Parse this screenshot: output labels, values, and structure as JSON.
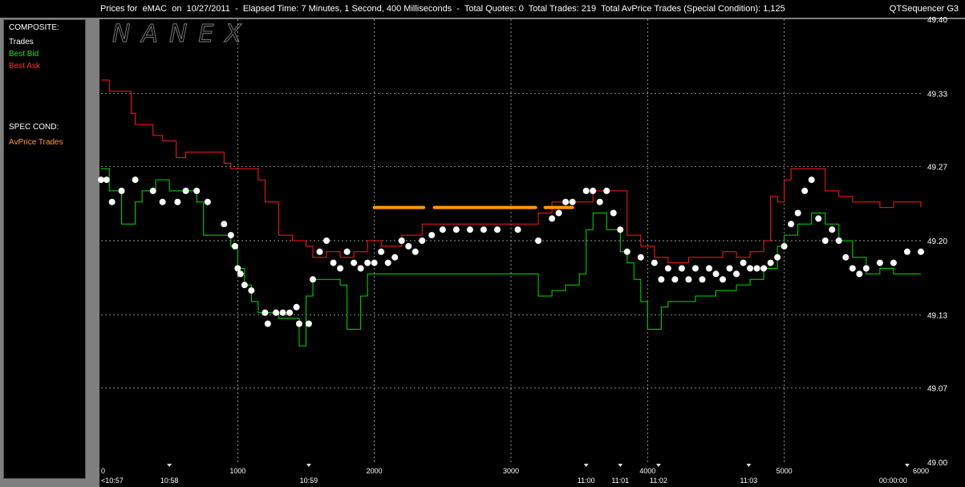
{
  "header": {
    "title": "Prices for  eMAC  on  10/27/2011  -  Elapsed Time: 7 Minutes, 1 Second, 400 Milliseconds  -  Total Quotes: 0  Total Trades: 219  Total AvPrice Trades (Special Condition): 1,125",
    "app": "QTSequencer G3"
  },
  "legend": {
    "composite": "COMPOSITE:",
    "trades": "Trades",
    "best_bid": "Best Bid",
    "best_ask": "Best Ask",
    "spec_cond": "SPEC COND:",
    "avprice": "AvPrice Trades"
  },
  "watermark": "NANEX",
  "colors": {
    "trades": "#ffffff",
    "bid": "#00dd00",
    "ask": "#ff1a1a",
    "avprice": "#ff9900",
    "grid": "#cccccc",
    "text": "#ffffff"
  },
  "chart_data": {
    "type": "line",
    "title": "",
    "ylim": [
      49.0,
      49.4
    ],
    "xlim": [
      0,
      6000
    ],
    "yticks": [
      "49.40",
      "49.33",
      "49.27",
      "49.20",
      "49.13",
      "49.07",
      "49.00"
    ],
    "yvals": [
      49.4,
      49.333,
      49.267,
      49.2,
      49.133,
      49.067,
      49.0
    ],
    "xticks": [
      {
        "v": 0,
        "l": "0"
      },
      {
        "v": 1000,
        "l": "1000"
      },
      {
        "v": 2000,
        "l": "2000"
      },
      {
        "v": 3000,
        "l": "3000"
      },
      {
        "v": 4000,
        "l": "4000"
      },
      {
        "v": 5000,
        "l": "5000"
      },
      {
        "v": 6000,
        "l": "6000"
      }
    ],
    "timeticks": [
      {
        "v": 0,
        "l": "<10:57"
      },
      {
        "v": 500,
        "l": "10:58"
      },
      {
        "v": 1520,
        "l": "10:59"
      },
      {
        "v": 3550,
        "l": "11:00"
      },
      {
        "v": 3800,
        "l": "11:01"
      },
      {
        "v": 4080,
        "l": "11:02"
      },
      {
        "v": 4740,
        "l": "11:03"
      },
      {
        "v": 5900,
        "l": "00:00:00"
      }
    ],
    "series": [
      {
        "name": "Best Ask",
        "key": "ask",
        "points": [
          [
            0,
            49.345
          ],
          [
            60,
            49.335
          ],
          [
            220,
            49.315
          ],
          [
            250,
            49.305
          ],
          [
            280,
            49.305
          ],
          [
            380,
            49.295
          ],
          [
            450,
            49.29
          ],
          [
            550,
            49.275
          ],
          [
            620,
            49.28
          ],
          [
            700,
            49.28
          ],
          [
            820,
            49.28
          ],
          [
            900,
            49.27
          ],
          [
            950,
            49.265
          ],
          [
            1050,
            49.265
          ],
          [
            1150,
            49.255
          ],
          [
            1200,
            49.235
          ],
          [
            1300,
            49.205
          ],
          [
            1400,
            49.2
          ],
          [
            1500,
            49.195
          ],
          [
            1550,
            49.185
          ],
          [
            1650,
            49.19
          ],
          [
            1750,
            49.185
          ],
          [
            1850,
            49.19
          ],
          [
            1950,
            49.2
          ],
          [
            2050,
            49.195
          ],
          [
            2200,
            49.205
          ],
          [
            2350,
            49.215
          ],
          [
            2500,
            49.215
          ],
          [
            2700,
            49.215
          ],
          [
            2900,
            49.215
          ],
          [
            3100,
            49.215
          ],
          [
            3200,
            49.225
          ],
          [
            3300,
            49.235
          ],
          [
            3400,
            49.235
          ],
          [
            3500,
            49.235
          ],
          [
            3600,
            49.245
          ],
          [
            3700,
            49.245
          ],
          [
            3800,
            49.245
          ],
          [
            3850,
            49.205
          ],
          [
            3950,
            49.195
          ],
          [
            4050,
            49.185
          ],
          [
            4150,
            49.18
          ],
          [
            4300,
            49.185
          ],
          [
            4400,
            49.185
          ],
          [
            4550,
            49.19
          ],
          [
            4650,
            49.185
          ],
          [
            4750,
            49.19
          ],
          [
            4850,
            49.2
          ],
          [
            4900,
            49.24
          ],
          [
            4950,
            49.235
          ],
          [
            5000,
            49.255
          ],
          [
            5050,
            49.265
          ],
          [
            5150,
            49.265
          ],
          [
            5300,
            49.245
          ],
          [
            5400,
            49.24
          ],
          [
            5500,
            49.235
          ],
          [
            5600,
            49.235
          ],
          [
            5700,
            49.23
          ],
          [
            5800,
            49.235
          ],
          [
            6000,
            49.23
          ]
        ]
      },
      {
        "name": "Best Bid",
        "key": "bid",
        "points": [
          [
            0,
            49.265
          ],
          [
            60,
            49.245
          ],
          [
            150,
            49.215
          ],
          [
            250,
            49.235
          ],
          [
            300,
            49.245
          ],
          [
            400,
            49.255
          ],
          [
            500,
            49.245
          ],
          [
            600,
            49.245
          ],
          [
            700,
            49.235
          ],
          [
            750,
            49.205
          ],
          [
            850,
            49.205
          ],
          [
            950,
            49.195
          ],
          [
            1000,
            49.175
          ],
          [
            1050,
            49.16
          ],
          [
            1100,
            49.145
          ],
          [
            1150,
            49.135
          ],
          [
            1250,
            49.135
          ],
          [
            1300,
            49.13
          ],
          [
            1350,
            49.13
          ],
          [
            1400,
            49.13
          ],
          [
            1450,
            49.105
          ],
          [
            1500,
            49.15
          ],
          [
            1550,
            49.165
          ],
          [
            1650,
            49.165
          ],
          [
            1750,
            49.16
          ],
          [
            1800,
            49.12
          ],
          [
            1850,
            49.12
          ],
          [
            1900,
            49.15
          ],
          [
            1950,
            49.17
          ],
          [
            2000,
            49.17
          ],
          [
            2050,
            49.17
          ],
          [
            2150,
            49.17
          ],
          [
            2350,
            49.17
          ],
          [
            2500,
            49.17
          ],
          [
            2700,
            49.17
          ],
          [
            2900,
            49.17
          ],
          [
            3100,
            49.17
          ],
          [
            3200,
            49.15
          ],
          [
            3300,
            49.155
          ],
          [
            3400,
            49.16
          ],
          [
            3500,
            49.17
          ],
          [
            3550,
            49.21
          ],
          [
            3600,
            49.225
          ],
          [
            3700,
            49.21
          ],
          [
            3800,
            49.19
          ],
          [
            3850,
            49.18
          ],
          [
            3900,
            49.165
          ],
          [
            3950,
            49.145
          ],
          [
            4000,
            49.12
          ],
          [
            4050,
            49.12
          ],
          [
            4100,
            49.14
          ],
          [
            4150,
            49.145
          ],
          [
            4250,
            49.145
          ],
          [
            4350,
            49.15
          ],
          [
            4500,
            49.155
          ],
          [
            4650,
            49.16
          ],
          [
            4750,
            49.165
          ],
          [
            4850,
            49.175
          ],
          [
            4950,
            49.195
          ],
          [
            5000,
            49.205
          ],
          [
            5100,
            49.215
          ],
          [
            5200,
            49.225
          ],
          [
            5300,
            49.215
          ],
          [
            5400,
            49.2
          ],
          [
            5500,
            49.185
          ],
          [
            5600,
            49.17
          ],
          [
            5700,
            49.175
          ],
          [
            5800,
            49.17
          ],
          [
            6000,
            49.17
          ]
        ]
      }
    ],
    "trades": [
      [
        0,
        49.255
      ],
      [
        40,
        49.255
      ],
      [
        80,
        49.235
      ],
      [
        150,
        49.245
      ],
      [
        250,
        49.255
      ],
      [
        380,
        49.245
      ],
      [
        450,
        49.235
      ],
      [
        560,
        49.235
      ],
      [
        620,
        49.245
      ],
      [
        700,
        49.245
      ],
      [
        780,
        49.235
      ],
      [
        900,
        49.215
      ],
      [
        950,
        49.205
      ],
      [
        980,
        49.195
      ],
      [
        1000,
        49.175
      ],
      [
        1020,
        49.17
      ],
      [
        1050,
        49.16
      ],
      [
        1100,
        49.155
      ],
      [
        1200,
        49.135
      ],
      [
        1220,
        49.125
      ],
      [
        1280,
        49.135
      ],
      [
        1330,
        49.135
      ],
      [
        1380,
        49.135
      ],
      [
        1430,
        49.14
      ],
      [
        1450,
        49.125
      ],
      [
        1520,
        49.125
      ],
      [
        1550,
        49.165
      ],
      [
        1600,
        49.19
      ],
      [
        1650,
        49.2
      ],
      [
        1700,
        49.18
      ],
      [
        1750,
        49.175
      ],
      [
        1800,
        49.19
      ],
      [
        1850,
        49.18
      ],
      [
        1900,
        49.175
      ],
      [
        1950,
        49.18
      ],
      [
        2000,
        49.18
      ],
      [
        2050,
        49.19
      ],
      [
        2100,
        49.18
      ],
      [
        2150,
        49.185
      ],
      [
        2200,
        49.2
      ],
      [
        2250,
        49.195
      ],
      [
        2300,
        49.19
      ],
      [
        2350,
        49.2
      ],
      [
        2420,
        49.205
      ],
      [
        2500,
        49.21
      ],
      [
        2600,
        49.21
      ],
      [
        2700,
        49.21
      ],
      [
        2800,
        49.21
      ],
      [
        2900,
        49.21
      ],
      [
        3050,
        49.21
      ],
      [
        3200,
        49.2
      ],
      [
        3300,
        49.22
      ],
      [
        3350,
        49.225
      ],
      [
        3400,
        49.235
      ],
      [
        3450,
        49.235
      ],
      [
        3550,
        49.245
      ],
      [
        3600,
        49.245
      ],
      [
        3650,
        49.235
      ],
      [
        3700,
        49.245
      ],
      [
        3750,
        49.225
      ],
      [
        3800,
        49.21
      ],
      [
        3850,
        49.19
      ],
      [
        3950,
        49.185
      ],
      [
        4050,
        49.18
      ],
      [
        4100,
        49.165
      ],
      [
        4150,
        49.175
      ],
      [
        4200,
        49.165
      ],
      [
        4250,
        49.175
      ],
      [
        4300,
        49.165
      ],
      [
        4350,
        49.175
      ],
      [
        4400,
        49.165
      ],
      [
        4450,
        49.175
      ],
      [
        4500,
        49.17
      ],
      [
        4550,
        49.165
      ],
      [
        4600,
        49.175
      ],
      [
        4650,
        49.17
      ],
      [
        4700,
        49.18
      ],
      [
        4750,
        49.175
      ],
      [
        4800,
        49.175
      ],
      [
        4850,
        49.175
      ],
      [
        4900,
        49.18
      ],
      [
        4950,
        49.185
      ],
      [
        5000,
        49.195
      ],
      [
        5050,
        49.215
      ],
      [
        5100,
        49.225
      ],
      [
        5150,
        49.245
      ],
      [
        5200,
        49.255
      ],
      [
        5250,
        49.22
      ],
      [
        5300,
        49.2
      ],
      [
        5350,
        49.21
      ],
      [
        5400,
        49.2
      ],
      [
        5450,
        49.185
      ],
      [
        5500,
        49.175
      ],
      [
        5550,
        49.17
      ],
      [
        5600,
        49.175
      ],
      [
        5700,
        49.18
      ],
      [
        5800,
        49.18
      ],
      [
        5900,
        49.19
      ],
      [
        6000,
        49.19
      ]
    ],
    "avprice": [
      [
        2000,
        2360
      ],
      [
        2440,
        3180
      ],
      [
        3250,
        3450
      ]
    ],
    "avprice_y": 49.23
  }
}
